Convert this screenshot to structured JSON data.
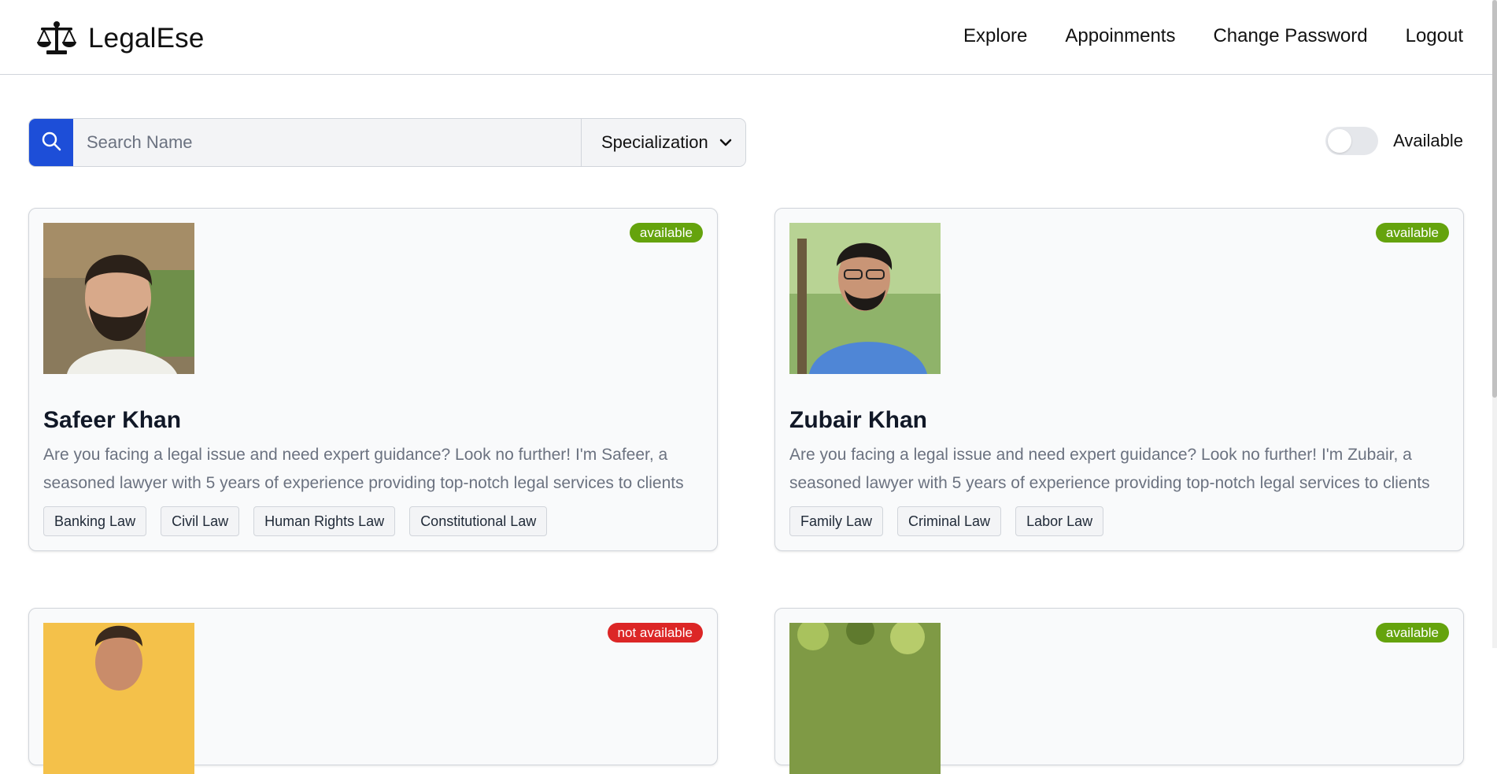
{
  "navbar": {
    "brand": "LegalEse",
    "links": [
      {
        "label": "Explore"
      },
      {
        "label": "Appoinments"
      },
      {
        "label": "Change Password"
      },
      {
        "label": "Logout"
      }
    ]
  },
  "filters": {
    "search_placeholder": "Search Name",
    "search_value": "",
    "specialization_label": "Specialization",
    "available_label": "Available",
    "available_toggle_on": false
  },
  "colors": {
    "primary": "#1d4ed8",
    "available": "#65a30d",
    "not_available": "#dc2626"
  },
  "lawyers": [
    {
      "name": "Safeer Khan",
      "status": "available",
      "bio": "Are you facing a legal issue and need expert guidance? Look no further! I'm Safeer, a seasoned lawyer with 5 years of experience providing top-notch legal services to clients",
      "tags": [
        "Banking Law",
        "Civil Law",
        "Human Rights Law",
        "Constitutional Law"
      ]
    },
    {
      "name": "Zubair Khan",
      "status": "available",
      "bio": "Are you facing a legal issue and need expert guidance? Look no further! I'm Zubair, a seasoned lawyer with 5 years of experience providing top-notch legal services to clients",
      "tags": [
        "Family Law",
        "Criminal Law",
        "Labor Law"
      ]
    },
    {
      "status": "not available"
    },
    {
      "status": "available"
    }
  ]
}
